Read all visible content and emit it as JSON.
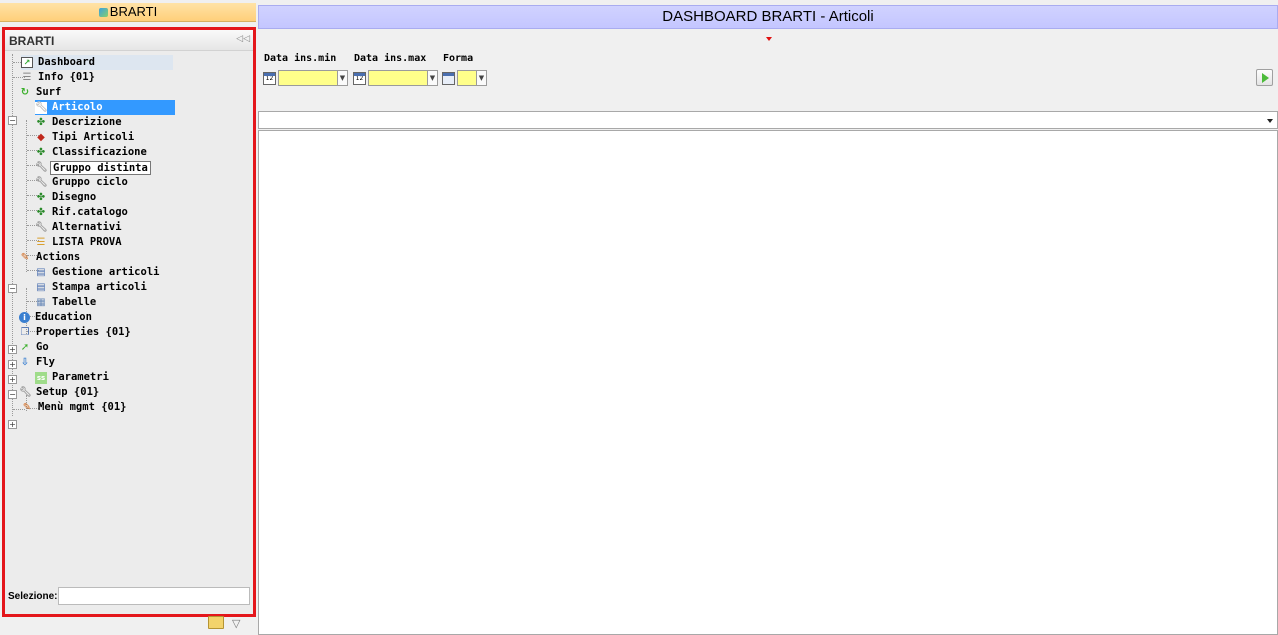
{
  "left_title": "BRARTI",
  "panel": {
    "title": "BRARTI",
    "collapse_icon": "double-chevron-left-icon",
    "selection_label": "Selezione:"
  },
  "tree": [
    {
      "label": "Dashboard",
      "icon": "dashboard-icon",
      "level": 1,
      "state": "highlighted"
    },
    {
      "label": "Info {01}",
      "icon": "list-icon",
      "level": 1
    },
    {
      "label": "Surf",
      "icon": "refresh-green-icon",
      "level": 0,
      "expanded": true
    },
    {
      "label": "Articolo",
      "icon": "wrench-icon",
      "level": 2,
      "state": "selected"
    },
    {
      "label": "Descrizione",
      "icon": "molecule-icon",
      "level": 2
    },
    {
      "label": "Tipi Articoli",
      "icon": "cube-icon",
      "level": 2
    },
    {
      "label": "Classificazione",
      "icon": "molecule-icon",
      "level": 2
    },
    {
      "label": "Gruppo distinta",
      "icon": "wrench-icon",
      "level": 2,
      "state": "hover"
    },
    {
      "label": "Gruppo ciclo",
      "icon": "wrench-icon",
      "level": 2
    },
    {
      "label": "Disegno",
      "icon": "molecule-icon",
      "level": 2
    },
    {
      "label": "Rif.catalogo",
      "icon": "molecule-icon",
      "level": 2
    },
    {
      "label": "Alternativi",
      "icon": "wrench-icon",
      "level": 2
    },
    {
      "label": "LISTA PROVA",
      "icon": "list-icon",
      "level": 2
    },
    {
      "label": "Actions",
      "icon": "edit-icon",
      "level": 0,
      "expanded": true
    },
    {
      "label": "Gestione articoli",
      "icon": "monitor-icon",
      "level": 2
    },
    {
      "label": "Stampa articoli",
      "icon": "monitor-icon",
      "level": 2
    },
    {
      "label": "Tabelle",
      "icon": "table-icon",
      "level": 2
    },
    {
      "label": "Education",
      "icon": "info-icon",
      "level": 0,
      "expanded": false
    },
    {
      "label": "Properties {01}",
      "icon": "properties-icon",
      "level": 0,
      "expanded": false
    },
    {
      "label": "Go",
      "icon": "go-icon",
      "level": 0,
      "expanded": false
    },
    {
      "label": "Fly",
      "icon": "download-arrow-icon",
      "level": 0,
      "expanded": true
    },
    {
      "label": "Parametri",
      "icon": "parameters-icon",
      "level": 2
    },
    {
      "label": "Setup {01}",
      "icon": "wrench-icon",
      "level": 0,
      "expanded": false
    },
    {
      "label": "Menù mgmt {01}",
      "icon": "edit-icon",
      "level": 1
    }
  ],
  "dashboard": {
    "title": "DASHBOARD BRARTI - Articoli",
    "filters": [
      {
        "label": "Data ins.min",
        "value": ""
      },
      {
        "label": "Data ins.max",
        "value": ""
      },
      {
        "label": "Forma",
        "value": ""
      }
    ],
    "run_icon": "play-icon",
    "select_value": ""
  },
  "colors": {
    "selection_border": "#e4161b",
    "selected_item": "#3399ff",
    "title_bar": "#c8caff",
    "left_title": "#ffd78c",
    "input_yellow": "#ffff8a"
  }
}
